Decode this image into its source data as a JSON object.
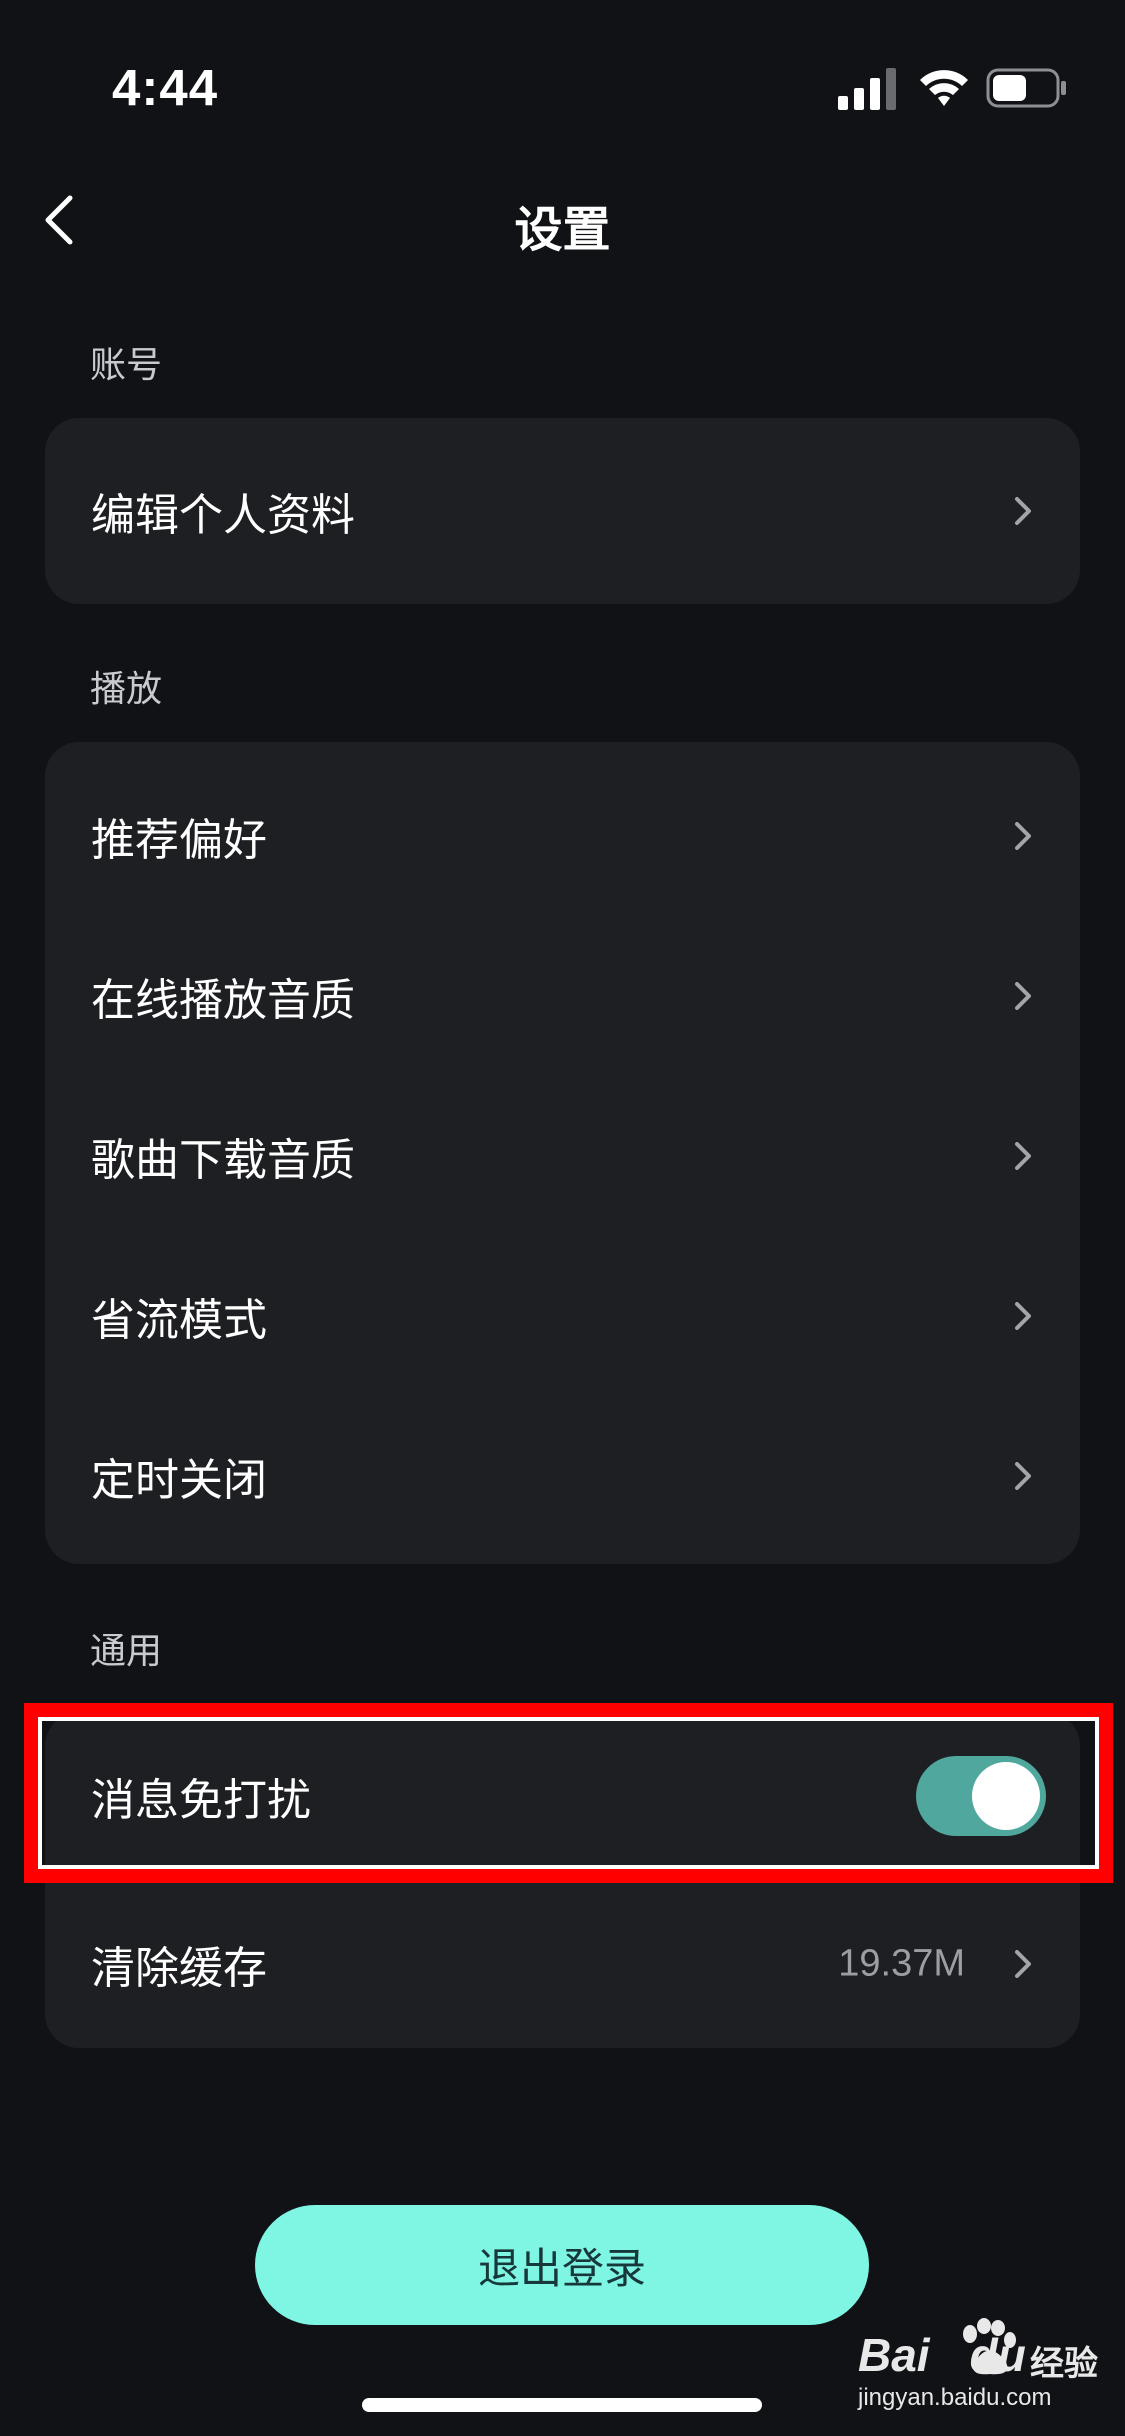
{
  "status_bar": {
    "time": "4:44",
    "signal_icon": "cellular-signal-icon",
    "wifi_icon": "wifi-icon",
    "battery_icon": "battery-icon",
    "battery_level": 0.55
  },
  "nav": {
    "title": "设置",
    "back_icon": "chevron-left-icon"
  },
  "sections": {
    "account": {
      "label": "账号",
      "items": [
        {
          "label": "编辑个人资料"
        }
      ]
    },
    "playback": {
      "label": "播放",
      "items": [
        {
          "label": "推荐偏好"
        },
        {
          "label": "在线播放音质"
        },
        {
          "label": "歌曲下载音质"
        },
        {
          "label": "省流模式"
        },
        {
          "label": "定时关闭"
        }
      ]
    },
    "general": {
      "label": "通用",
      "dnd": {
        "label": "消息免打扰",
        "toggle_on": true
      },
      "cache": {
        "label": "清除缓存",
        "value": "19.37M"
      }
    }
  },
  "logout_button": "退出登录",
  "watermark": {
    "brand": "Bai",
    "brand_tail": "du",
    "product": "经验",
    "url": "jingyan.baidu.com"
  },
  "colors": {
    "background": "#111216",
    "card": "#1e1f23",
    "toggle_on": "#4fa79d",
    "logout_button": "#7ff5e3",
    "highlight": "#ff0000"
  }
}
